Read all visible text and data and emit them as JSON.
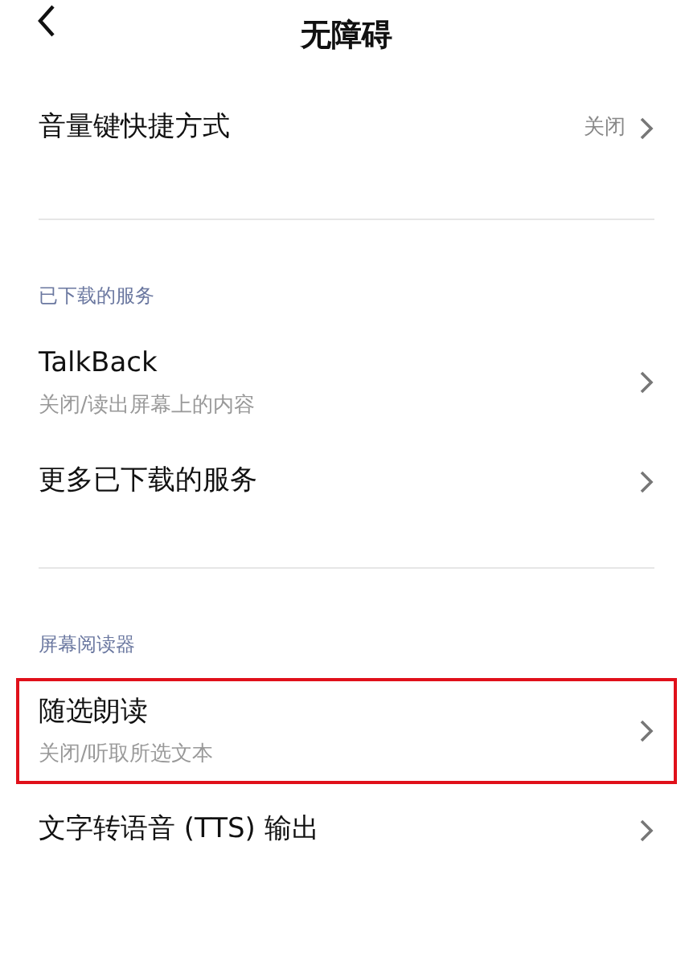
{
  "header": {
    "title": "无障碍"
  },
  "groups": [
    {
      "items": [
        {
          "label": "音量键快捷方式",
          "value": "关闭",
          "highlighted": false
        }
      ]
    },
    {
      "heading": "已下载的服务",
      "items": [
        {
          "label": "TalkBack",
          "subtitle": "关闭/读出屏幕上的内容",
          "highlighted": false
        },
        {
          "label": "更多已下载的服务",
          "highlighted": false
        }
      ]
    },
    {
      "heading": "屏幕阅读器",
      "items": [
        {
          "label": "随选朗读",
          "subtitle": "关闭/听取所选文本",
          "highlighted": true
        },
        {
          "label": "文字转语音 (TTS) 输出",
          "highlighted": false
        }
      ]
    }
  ]
}
